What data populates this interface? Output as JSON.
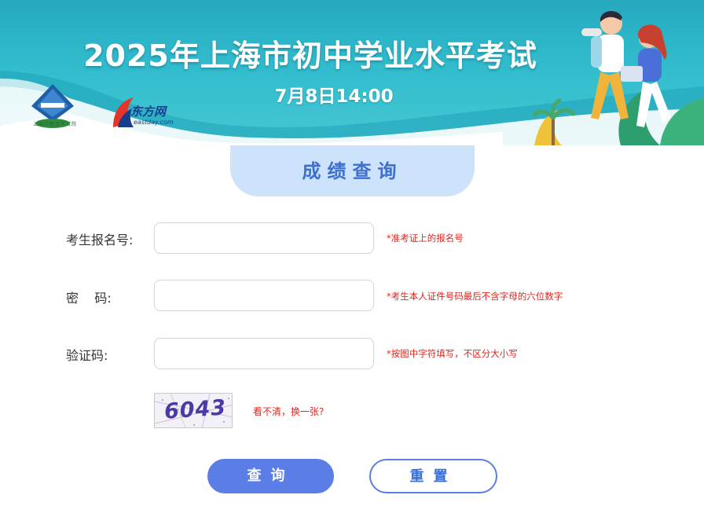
{
  "banner": {
    "title": "2025年上海市初中学业水平考试",
    "datetime": "7月8日14:00",
    "logo_left_caption": "上海市教育考试院",
    "logo_right_name": "东方网",
    "logo_right_url": "eastday.com"
  },
  "query_section": {
    "heading": "成绩查询"
  },
  "form": {
    "fields": [
      {
        "label": "考生报名号:",
        "value": "",
        "placeholder": "",
        "hint": "*准考证上的报名号"
      },
      {
        "label": "密    码:",
        "value": "",
        "placeholder": "",
        "hint": "*考生本人证件号码最后不含字母的六位数字"
      },
      {
        "label": "验证码:",
        "value": "",
        "placeholder": "",
        "hint": "*按图中字符填写，不区分大小写"
      }
    ],
    "captcha": {
      "text": "6043",
      "refresh_label": "看不清，换一张?"
    }
  },
  "buttons": {
    "query_label": "查询",
    "reset_label": "重置"
  },
  "colors": {
    "banner_teal": "#31bccd",
    "tab_bg": "#cde2fb",
    "accent_blue": "#5b7ee6",
    "hint_red": "#e0251f"
  },
  "icons": {
    "logo_left": "smeea-logo-icon",
    "logo_right": "eastday-logo-icon"
  }
}
